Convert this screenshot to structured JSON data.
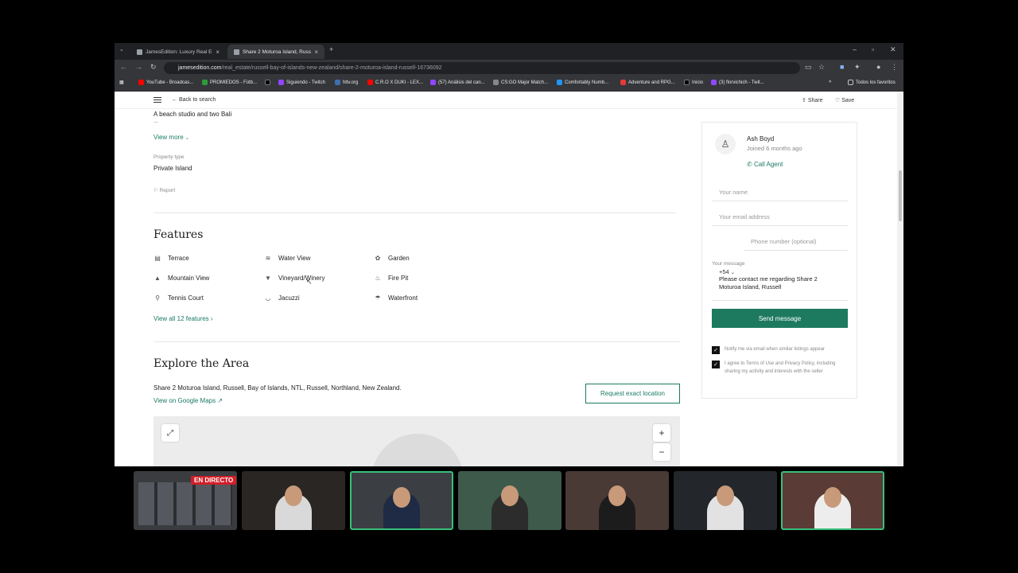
{
  "browser": {
    "tabs": [
      {
        "title": "JamesEdition: Luxury Real Estate"
      },
      {
        "title": "Share 2 Moturoa Island, Russell"
      }
    ],
    "new_tab": "+",
    "tab_close": "×",
    "url_host": "jamesedition.com",
    "url_path": "/real_estate/russell-bay-of-islands-new-zealand/share-2-moturoa-island-russell-16736092",
    "bookmarks": [
      {
        "label": "YouTube - Broadcas...",
        "color": "#ff0000"
      },
      {
        "label": "PROMIEDOS - Fútb...",
        "color": "#2e9b3a"
      },
      {
        "label": "",
        "color": "#000000"
      },
      {
        "label": "Siguiendo - Twitch",
        "color": "#9146ff"
      },
      {
        "label": "hltv.org",
        "color": "#3c6fb0"
      },
      {
        "label": "C.R.O X DUKI - LEX...",
        "color": "#ff0000"
      },
      {
        "label": "(57) Análisis del can...",
        "color": "#9146ff"
      },
      {
        "label": "CS:GO Major Match...",
        "color": "#888888"
      },
      {
        "label": "Comfortably Numb...",
        "color": "#2196f3"
      },
      {
        "label": "Adventure and RPG...",
        "color": "#e53935"
      },
      {
        "label": "Inicio",
        "color": "#000000"
      },
      {
        "label": "(3) florvichich - Twit...",
        "color": "#9146ff"
      }
    ],
    "bookmarks_more": "»",
    "all_bookmarks": "Todos los favoritos"
  },
  "nav": {
    "back": "Back to search",
    "share": "Share",
    "save": "Save"
  },
  "listing": {
    "description": "A beach studio and two Bali",
    "ellipsis": "...",
    "view_more": "View more",
    "property_type_label": "Property type",
    "property_type": "Private Island",
    "report": "Report"
  },
  "features": {
    "title": "Features",
    "items": [
      {
        "label": "Terrace",
        "icon": "terrace-icon"
      },
      {
        "label": "Water View",
        "icon": "water-view-icon"
      },
      {
        "label": "Garden",
        "icon": "garden-icon"
      },
      {
        "label": "Mountain View",
        "icon": "mountain-view-icon"
      },
      {
        "label": "Vineyard/Winery",
        "icon": "wine-glass-icon"
      },
      {
        "label": "Fire Pit",
        "icon": "fire-pit-icon"
      },
      {
        "label": "Tennis Court",
        "icon": "tennis-racket-icon"
      },
      {
        "label": "Jacuzzi",
        "icon": "jacuzzi-icon"
      },
      {
        "label": "Waterfront",
        "icon": "waterfront-icon"
      }
    ],
    "view_all": "View all 12 features"
  },
  "explore": {
    "title": "Explore the Area",
    "address": "Share 2 Moturoa Island, Russell, Bay of Islands, NTL, Russell, Northland, New Zealand.",
    "google_maps": "View on Google Maps",
    "request_location": "Request exact location",
    "zoom_in": "+",
    "zoom_out": "−"
  },
  "agent": {
    "name": "Ash Boyd",
    "joined": "Joined 6 months ago",
    "call": "Call Agent",
    "name_placeholder": "Your name",
    "email_placeholder": "Your email address",
    "phone_prefix": "+54",
    "phone_placeholder": "Phone number (optional)",
    "message_label": "Your message",
    "message": "Please contact me regarding Share 2 Moturoa Island, Russell",
    "send": "Send message",
    "notify_text": "Notify me via email when similar listings appear",
    "terms_text": "I agree to Terms of Use and Privacy Policy, including sharing my activity and interests with the seller"
  },
  "stream": {
    "live_badge": "EN DIRECTO"
  },
  "colors": {
    "accent": "#1e7a5f",
    "browser_dark": "#202124",
    "highlight": "#37c07b"
  }
}
